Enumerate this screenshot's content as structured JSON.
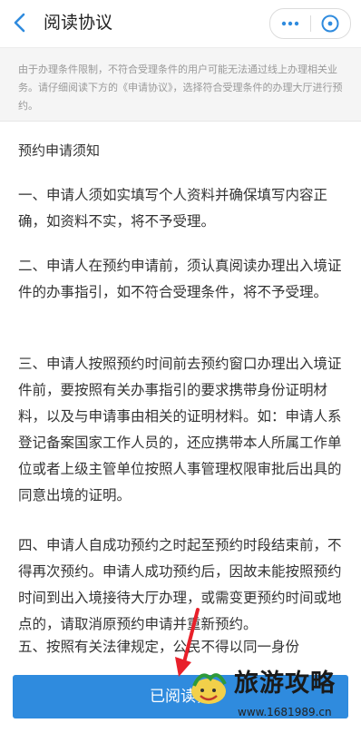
{
  "header": {
    "title": "阅读协议",
    "back_icon": "chevron-left-icon",
    "more_icon": "more-dots-icon",
    "close_icon": "close-circle-icon"
  },
  "notice": {
    "text": "由于办理条件限制，不符合受理条件的用户可能无法通过线上办理相关业务。请仔细阅读下方的《申请协议》，选择符合受理条件的办理大厅进行预约。"
  },
  "agreement": {
    "title": "预约申请须知",
    "clauses": [
      "一、申请人须如实填写个人资料并确保填写内容正确，如资料不实，将不予受理。",
      "二、申请人在预约申请前，须认真阅读办理出入境证件的办事指引，如不符合受理条件，将不予受理。",
      "三、申请人按照预约时间前去预约窗口办理出入境证件前，要按照有关办事指引的要求携带身份证明材料，以及与申请事由相关的证明材料。如：申请人系登记备案国家工作人员的，还应携带本人所属工作单位或者上级主管单位按照人事管理权限审批后出具的同意出境的证明。",
      "四、申请人自成功预约之时起至预约时段结束前，不得再次预约。申请人成功预约后，因故未能按照预约时间到出入境接待大厅办理，或需变更预约时间或地点的，请取消原预约申请并重新预约。",
      "五、按照有关法律规定，公民不得以同一身份"
    ]
  },
  "bottom_button": {
    "label": "已阅读，"
  },
  "watermark": {
    "brand": "旅游攻略",
    "url": "www.1681989.cn"
  },
  "colors": {
    "accent": "#2f8bde",
    "notice_bg": "#f5f5f5",
    "arrow": "#e8202a"
  }
}
